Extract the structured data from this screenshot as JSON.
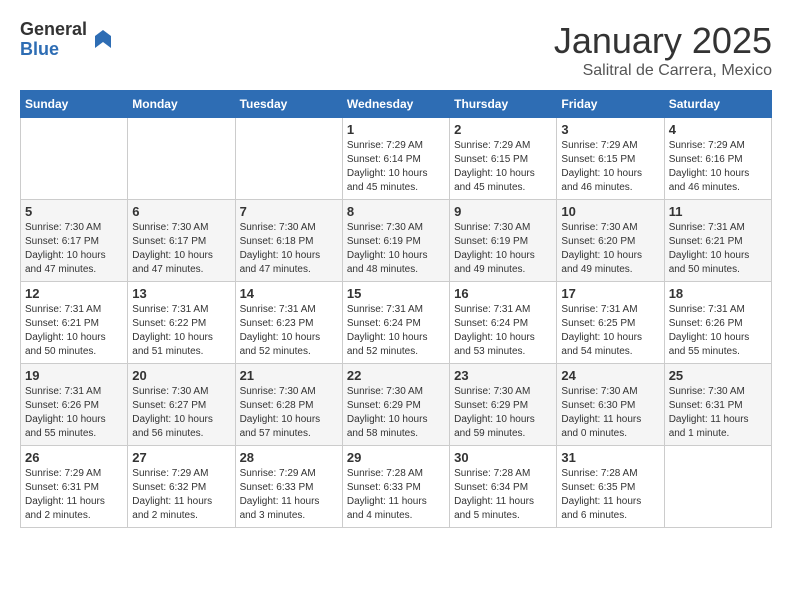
{
  "logo": {
    "general": "General",
    "blue": "Blue"
  },
  "title": "January 2025",
  "subtitle": "Salitral de Carrera, Mexico",
  "days_of_week": [
    "Sunday",
    "Monday",
    "Tuesday",
    "Wednesday",
    "Thursday",
    "Friday",
    "Saturday"
  ],
  "weeks": [
    [
      {
        "day": "",
        "info": ""
      },
      {
        "day": "",
        "info": ""
      },
      {
        "day": "",
        "info": ""
      },
      {
        "day": "1",
        "info": "Sunrise: 7:29 AM\nSunset: 6:14 PM\nDaylight: 10 hours\nand 45 minutes."
      },
      {
        "day": "2",
        "info": "Sunrise: 7:29 AM\nSunset: 6:15 PM\nDaylight: 10 hours\nand 45 minutes."
      },
      {
        "day": "3",
        "info": "Sunrise: 7:29 AM\nSunset: 6:15 PM\nDaylight: 10 hours\nand 46 minutes."
      },
      {
        "day": "4",
        "info": "Sunrise: 7:29 AM\nSunset: 6:16 PM\nDaylight: 10 hours\nand 46 minutes."
      }
    ],
    [
      {
        "day": "5",
        "info": "Sunrise: 7:30 AM\nSunset: 6:17 PM\nDaylight: 10 hours\nand 47 minutes."
      },
      {
        "day": "6",
        "info": "Sunrise: 7:30 AM\nSunset: 6:17 PM\nDaylight: 10 hours\nand 47 minutes."
      },
      {
        "day": "7",
        "info": "Sunrise: 7:30 AM\nSunset: 6:18 PM\nDaylight: 10 hours\nand 47 minutes."
      },
      {
        "day": "8",
        "info": "Sunrise: 7:30 AM\nSunset: 6:19 PM\nDaylight: 10 hours\nand 48 minutes."
      },
      {
        "day": "9",
        "info": "Sunrise: 7:30 AM\nSunset: 6:19 PM\nDaylight: 10 hours\nand 49 minutes."
      },
      {
        "day": "10",
        "info": "Sunrise: 7:30 AM\nSunset: 6:20 PM\nDaylight: 10 hours\nand 49 minutes."
      },
      {
        "day": "11",
        "info": "Sunrise: 7:31 AM\nSunset: 6:21 PM\nDaylight: 10 hours\nand 50 minutes."
      }
    ],
    [
      {
        "day": "12",
        "info": "Sunrise: 7:31 AM\nSunset: 6:21 PM\nDaylight: 10 hours\nand 50 minutes."
      },
      {
        "day": "13",
        "info": "Sunrise: 7:31 AM\nSunset: 6:22 PM\nDaylight: 10 hours\nand 51 minutes."
      },
      {
        "day": "14",
        "info": "Sunrise: 7:31 AM\nSunset: 6:23 PM\nDaylight: 10 hours\nand 52 minutes."
      },
      {
        "day": "15",
        "info": "Sunrise: 7:31 AM\nSunset: 6:24 PM\nDaylight: 10 hours\nand 52 minutes."
      },
      {
        "day": "16",
        "info": "Sunrise: 7:31 AM\nSunset: 6:24 PM\nDaylight: 10 hours\nand 53 minutes."
      },
      {
        "day": "17",
        "info": "Sunrise: 7:31 AM\nSunset: 6:25 PM\nDaylight: 10 hours\nand 54 minutes."
      },
      {
        "day": "18",
        "info": "Sunrise: 7:31 AM\nSunset: 6:26 PM\nDaylight: 10 hours\nand 55 minutes."
      }
    ],
    [
      {
        "day": "19",
        "info": "Sunrise: 7:31 AM\nSunset: 6:26 PM\nDaylight: 10 hours\nand 55 minutes."
      },
      {
        "day": "20",
        "info": "Sunrise: 7:30 AM\nSunset: 6:27 PM\nDaylight: 10 hours\nand 56 minutes."
      },
      {
        "day": "21",
        "info": "Sunrise: 7:30 AM\nSunset: 6:28 PM\nDaylight: 10 hours\nand 57 minutes."
      },
      {
        "day": "22",
        "info": "Sunrise: 7:30 AM\nSunset: 6:29 PM\nDaylight: 10 hours\nand 58 minutes."
      },
      {
        "day": "23",
        "info": "Sunrise: 7:30 AM\nSunset: 6:29 PM\nDaylight: 10 hours\nand 59 minutes."
      },
      {
        "day": "24",
        "info": "Sunrise: 7:30 AM\nSunset: 6:30 PM\nDaylight: 11 hours\nand 0 minutes."
      },
      {
        "day": "25",
        "info": "Sunrise: 7:30 AM\nSunset: 6:31 PM\nDaylight: 11 hours\nand 1 minute."
      }
    ],
    [
      {
        "day": "26",
        "info": "Sunrise: 7:29 AM\nSunset: 6:31 PM\nDaylight: 11 hours\nand 2 minutes."
      },
      {
        "day": "27",
        "info": "Sunrise: 7:29 AM\nSunset: 6:32 PM\nDaylight: 11 hours\nand 2 minutes."
      },
      {
        "day": "28",
        "info": "Sunrise: 7:29 AM\nSunset: 6:33 PM\nDaylight: 11 hours\nand 3 minutes."
      },
      {
        "day": "29",
        "info": "Sunrise: 7:28 AM\nSunset: 6:33 PM\nDaylight: 11 hours\nand 4 minutes."
      },
      {
        "day": "30",
        "info": "Sunrise: 7:28 AM\nSunset: 6:34 PM\nDaylight: 11 hours\nand 5 minutes."
      },
      {
        "day": "31",
        "info": "Sunrise: 7:28 AM\nSunset: 6:35 PM\nDaylight: 11 hours\nand 6 minutes."
      },
      {
        "day": "",
        "info": ""
      }
    ]
  ]
}
